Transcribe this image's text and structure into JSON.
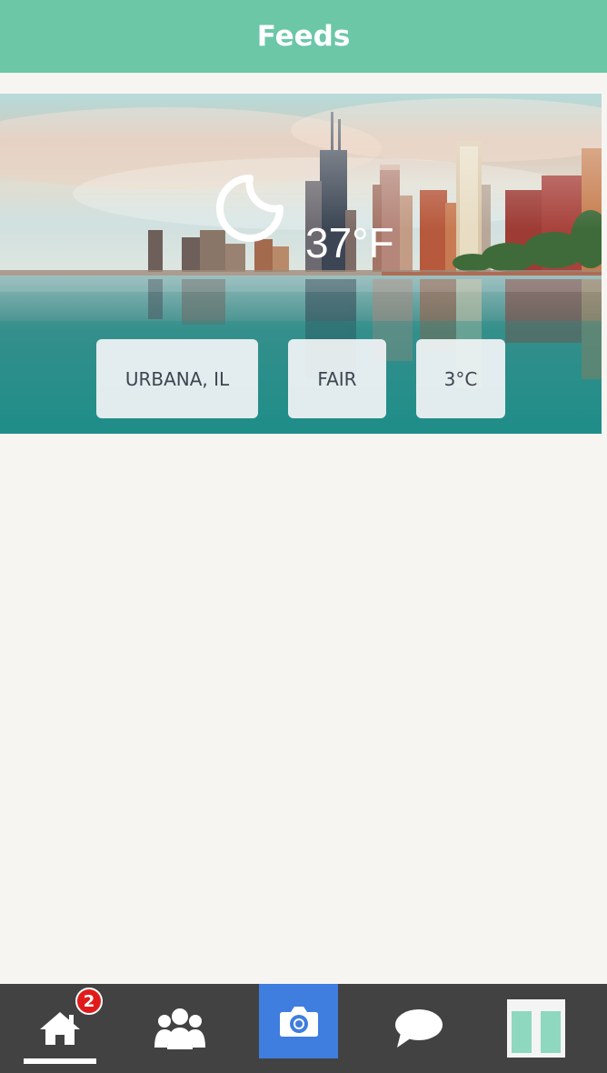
{
  "header": {
    "title": "Feeds"
  },
  "weather": {
    "icon": "moon-icon",
    "temperature_f": "37°F",
    "location": "URBANA, IL",
    "condition": "FAIR",
    "temperature_c": "3°C"
  },
  "tabbar": {
    "home_badge_count": "2",
    "items": [
      "home-icon",
      "groups-icon",
      "camera-icon",
      "chat-bubble-icon",
      "avatar"
    ],
    "active_tab": "home"
  },
  "colors": {
    "header_bg": "#6cc7a7",
    "tabbar_bg": "#424242",
    "camera_bg": "#3f7ddf",
    "badge_bg": "#e01b1b",
    "avatar_fill": "#8ed8c0"
  }
}
